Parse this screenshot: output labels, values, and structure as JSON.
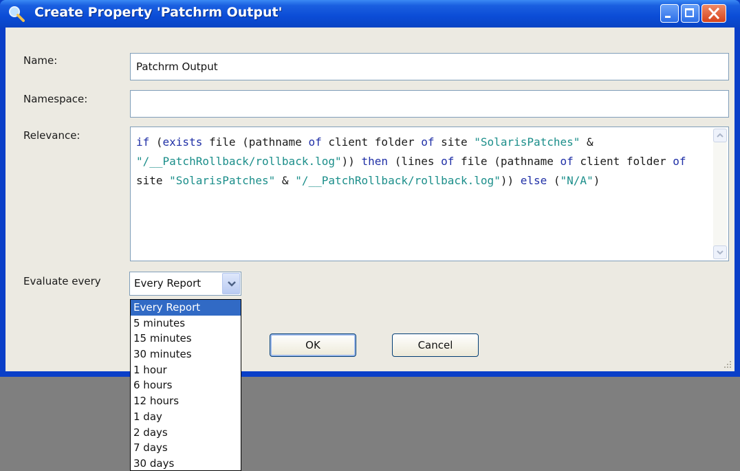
{
  "window": {
    "title": "Create Property 'Patchrm Output'"
  },
  "form": {
    "name_label": "Name:",
    "name_value": "Patchrm Output",
    "namespace_label": "Namespace:",
    "namespace_value": "",
    "relevance_label": "Relevance:",
    "relevance_tokens": [
      {
        "t": "if",
        "c": "kw"
      },
      {
        "t": " ("
      },
      {
        "t": "exists",
        "c": "kw"
      },
      {
        "t": " file (pathname "
      },
      {
        "t": "of",
        "c": "kw"
      },
      {
        "t": " client folder "
      },
      {
        "t": "of",
        "c": "kw"
      },
      {
        "t": " site "
      },
      {
        "t": "\"SolarisPatches\"",
        "c": "str"
      },
      {
        "t": " & "
      },
      {
        "t": "\"/__PatchRollback/rollback.log\"",
        "c": "str"
      },
      {
        "t": ")) "
      },
      {
        "t": "then",
        "c": "kw"
      },
      {
        "t": " (lines "
      },
      {
        "t": "of",
        "c": "kw"
      },
      {
        "t": " file (pathname "
      },
      {
        "t": "of",
        "c": "kw"
      },
      {
        "t": " client folder "
      },
      {
        "t": "of",
        "c": "kw"
      },
      {
        "t": " site "
      },
      {
        "t": "\"SolarisPatches\"",
        "c": "str"
      },
      {
        "t": " & "
      },
      {
        "t": "\"/__PatchRollback/rollback.log\"",
        "c": "str"
      },
      {
        "t": ")) "
      },
      {
        "t": "else",
        "c": "kw"
      },
      {
        "t": " ("
      },
      {
        "t": "\"N/A\"",
        "c": "str"
      },
      {
        "t": ")"
      }
    ],
    "evaluate_label": "Evaluate every",
    "evaluate_selected": "Every Report",
    "evaluate_options": [
      "Every Report",
      "5 minutes",
      "15 minutes",
      "30 minutes",
      "1 hour",
      "6 hours",
      "12 hours",
      "1 day",
      "2 days",
      "7 days",
      "30 days"
    ]
  },
  "buttons": {
    "ok": "OK",
    "cancel": "Cancel"
  },
  "colors": {
    "keyword": "#1f2fa6",
    "string": "#1b8e8a",
    "titlebar": "#0b4cd6",
    "selection": "#316ac5"
  }
}
